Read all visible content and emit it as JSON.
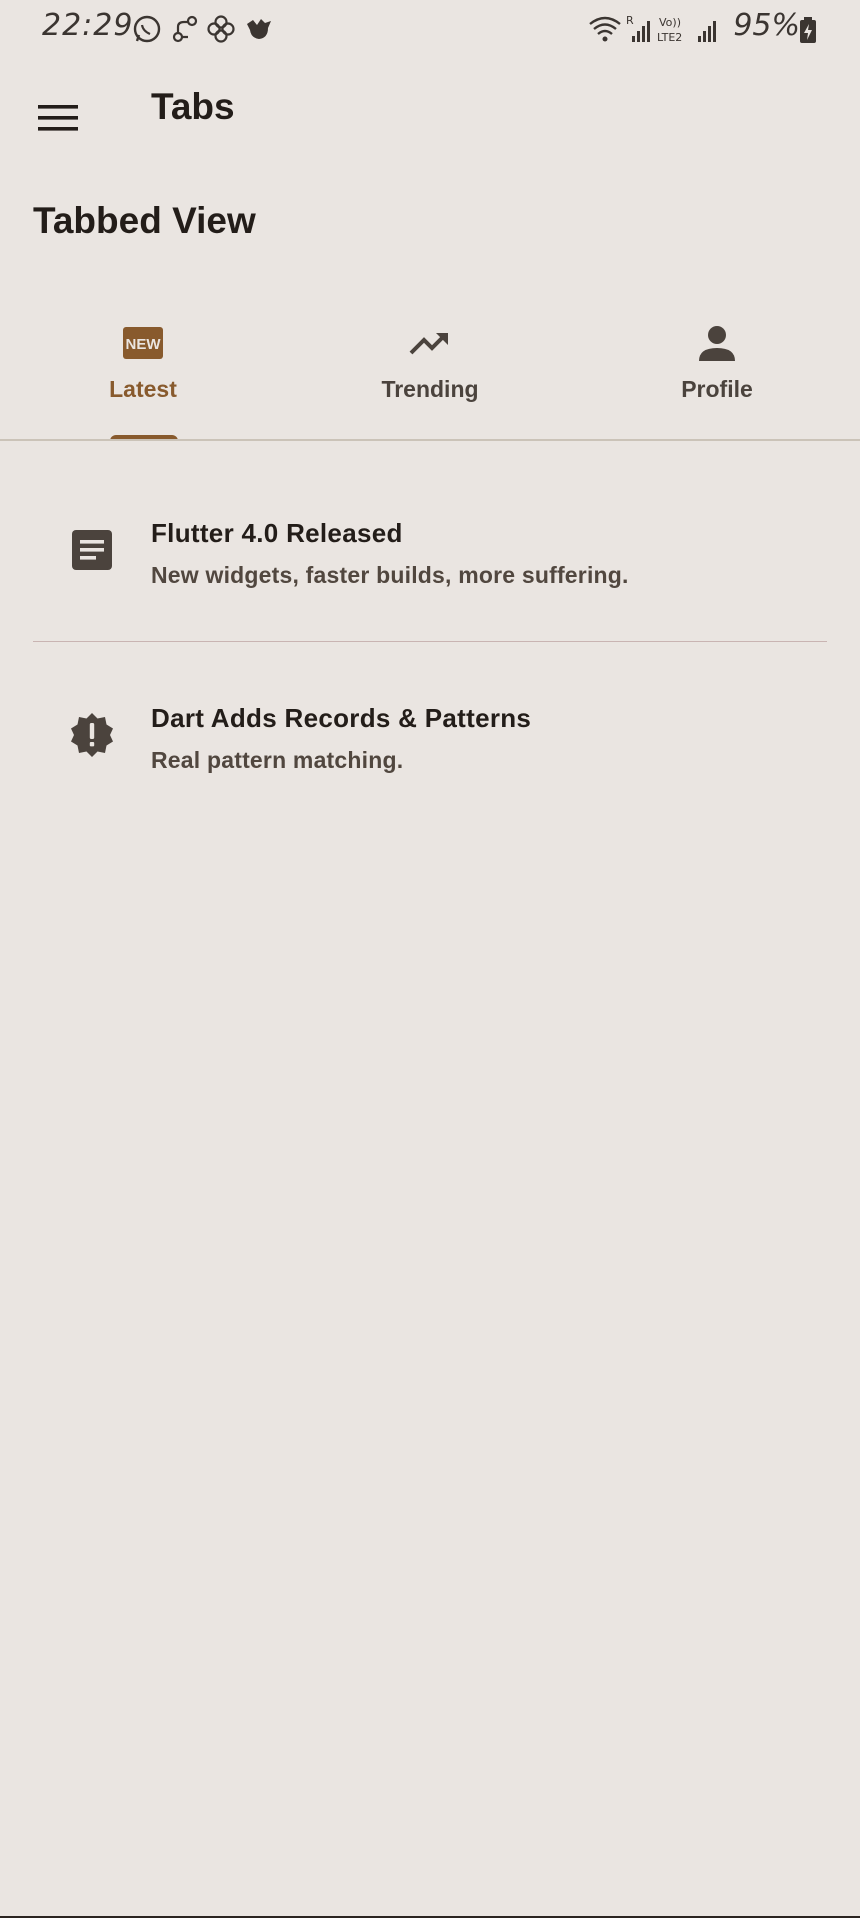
{
  "status_bar": {
    "time": "22:29",
    "battery": "95%",
    "notification_icons": [
      "whatsapp-icon",
      "link-icon",
      "flower-icon",
      "bird-icon"
    ],
    "system_icons": [
      "wifi-icon",
      "signal-r-icon",
      "volte-lte2-icon",
      "signal-icon",
      "battery-charging-icon"
    ]
  },
  "app_bar": {
    "title": "Tabs",
    "menu_icon": "menu-icon"
  },
  "section": {
    "heading": "Tabbed View"
  },
  "tabs": [
    {
      "label": "Latest",
      "icon": "new-badge-icon",
      "active": true
    },
    {
      "label": "Trending",
      "icon": "trending-up-icon",
      "active": false
    },
    {
      "label": "Profile",
      "icon": "person-icon",
      "active": false
    }
  ],
  "list": [
    {
      "title": "Flutter 4.0 Released",
      "subtitle": "New widgets, faster builds, more suffering.",
      "icon": "article-icon"
    },
    {
      "title": "Dart Adds Records & Patterns",
      "subtitle": "Real pattern matching.",
      "icon": "new-releases-icon"
    }
  ],
  "colors": {
    "background": "#eae5e1",
    "accent": "#885a2d",
    "text_primary": "#231d19",
    "text_secondary": "#51473f",
    "icon": "#4b433d"
  }
}
